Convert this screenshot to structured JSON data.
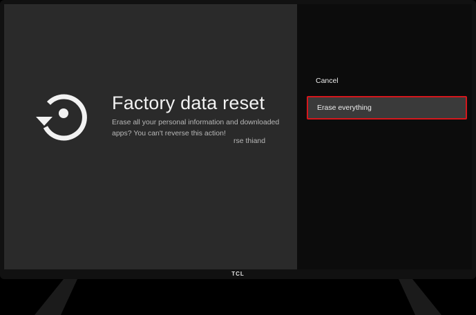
{
  "device": {
    "brand": "TCL"
  },
  "screen": {
    "title": "Factory data reset",
    "description": "Erase all your personal information and downloaded apps? You can't reverse this action!",
    "fragment": "rse thiand",
    "icon": "restore-icon"
  },
  "menu": {
    "items": [
      {
        "label": "Cancel",
        "selected": false
      },
      {
        "label": "Erase everything",
        "selected": true
      }
    ]
  },
  "colors": {
    "highlight_border": "#d6171c",
    "left_panel": "#2a2a2a",
    "right_panel": "#0c0c0c"
  }
}
